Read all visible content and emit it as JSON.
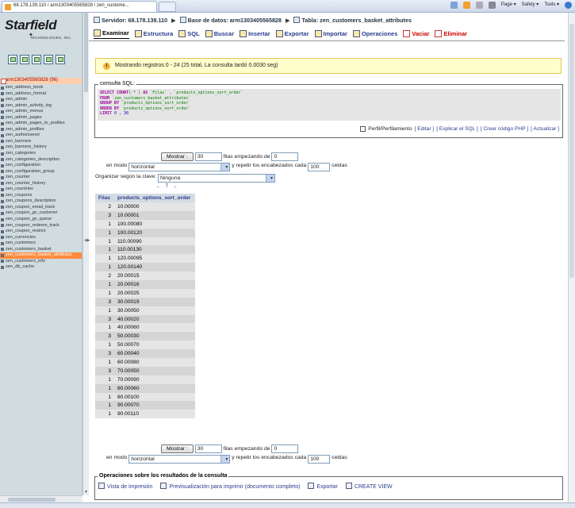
{
  "browser": {
    "tab_title": "68.178.139.110 / arm1303405565828 / zen_custome...",
    "commands": [
      "Page ▾",
      "Safety ▾",
      "Tools ▾"
    ]
  },
  "sidebar": {
    "logo_text": "Starfield",
    "logo_sub": "TECHNOLOGIES, INC.",
    "database": "arm1303405565828 (96)",
    "tables": [
      "zen_address_book",
      "zen_address_format",
      "zen_admin",
      "zen_admin_activity_log",
      "zen_admin_menus",
      "zen_admin_pages",
      "zen_admin_pages_to_profiles",
      "zen_admin_profiles",
      "zen_authorizenet",
      "zen_banners",
      "zen_banners_history",
      "zen_categories",
      "zen_categories_description",
      "zen_configuration",
      "zen_configuration_group",
      "zen_counter",
      "zen_counter_history",
      "zen_countries",
      "zen_coupons",
      "zen_coupons_description",
      "zen_coupon_email_track",
      "zen_coupon_gv_customer",
      "zen_coupon_gv_queue",
      "zen_coupon_redeem_track",
      "zen_coupon_restrict",
      "zen_currencies",
      "zen_customers",
      "zen_customers_basket",
      "zen_customers_basket_attributes",
      "zen_customers_info",
      "zen_db_cache"
    ],
    "active_index": 28
  },
  "breadcrumb": {
    "server": "Servidor: 68.178.139.110",
    "database": "Base de datos: arm1303405565828",
    "table": "Tabla: zen_customers_basket_attributes"
  },
  "tabs": [
    {
      "label": "Examinar",
      "active": true
    },
    {
      "label": "Estructura"
    },
    {
      "label": "SQL"
    },
    {
      "label": "Buscar"
    },
    {
      "label": "Insertar"
    },
    {
      "label": "Exportar"
    },
    {
      "label": "Importar"
    },
    {
      "label": "Operaciones"
    },
    {
      "label": "Vaciar",
      "danger": true
    },
    {
      "label": "Eliminar",
      "danger": true
    }
  ],
  "info_message": "Mostrando registros 0 - 24 (25 total, La consulta tardó 0.0030 seg)",
  "sql": {
    "legend": "consulta SQL:",
    "lines": [
      "SELECT COUNT( * ) AS `Filas` , `products_options_sort_order`",
      "FROM `zen_customers_basket_attributes`",
      "GROUP BY `products_options_sort_order`",
      "ORDER BY `products_options_sort_order`",
      "LIMIT 0 , 30"
    ],
    "profiling_label": "Perfil/Perfilamiento",
    "links": [
      "[ Editar ]",
      "[ Explicar el SQL ]",
      "[ Crear código PHP ]",
      "[ Actualizar ]"
    ]
  },
  "nav": {
    "show_button": "Mostrar :",
    "rows_value": "30",
    "rows_label": "filas empezando de",
    "start_value": "0",
    "mode_label": "en modo",
    "mode_value": "horizontal",
    "repeat_label": "y repetir los encabezados cada",
    "repeat_value": "100",
    "cells_label": "celdas",
    "sort_label": "Organizar según la clave:",
    "sort_value": "Ninguna"
  },
  "table": {
    "sort_arrows": "← T →",
    "headers": [
      "Filas",
      "products_options_sort_order"
    ],
    "rows": [
      [
        "2",
        "10.00000"
      ],
      [
        "3",
        "10.00001"
      ],
      [
        "1",
        "100.00080"
      ],
      [
        "1",
        "100.00120"
      ],
      [
        "1",
        "110.00090"
      ],
      [
        "1",
        "110.00130"
      ],
      [
        "1",
        "120.00095"
      ],
      [
        "1",
        "120.00140"
      ],
      [
        "2",
        "20.00015"
      ],
      [
        "1",
        "20.00016"
      ],
      [
        "1",
        "20.00025"
      ],
      [
        "3",
        "30.00019"
      ],
      [
        "1",
        "30.00050"
      ],
      [
        "3",
        "40.00020"
      ],
      [
        "1",
        "40.00060"
      ],
      [
        "3",
        "50.00030"
      ],
      [
        "1",
        "50.00070"
      ],
      [
        "3",
        "60.00040"
      ],
      [
        "1",
        "60.00080"
      ],
      [
        "3",
        "70.00050"
      ],
      [
        "1",
        "70.00090"
      ],
      [
        "1",
        "80.00060"
      ],
      [
        "1",
        "80.00100"
      ],
      [
        "1",
        "90.00070"
      ],
      [
        "1",
        "90.00110"
      ]
    ]
  },
  "operations": {
    "legend": "Operaciones sobre los resultados de la consulta",
    "links": [
      "Vista de impresión",
      "Previsualización para imprimir (documento completo)",
      "Exportar",
      "CREATE VIEW"
    ]
  }
}
